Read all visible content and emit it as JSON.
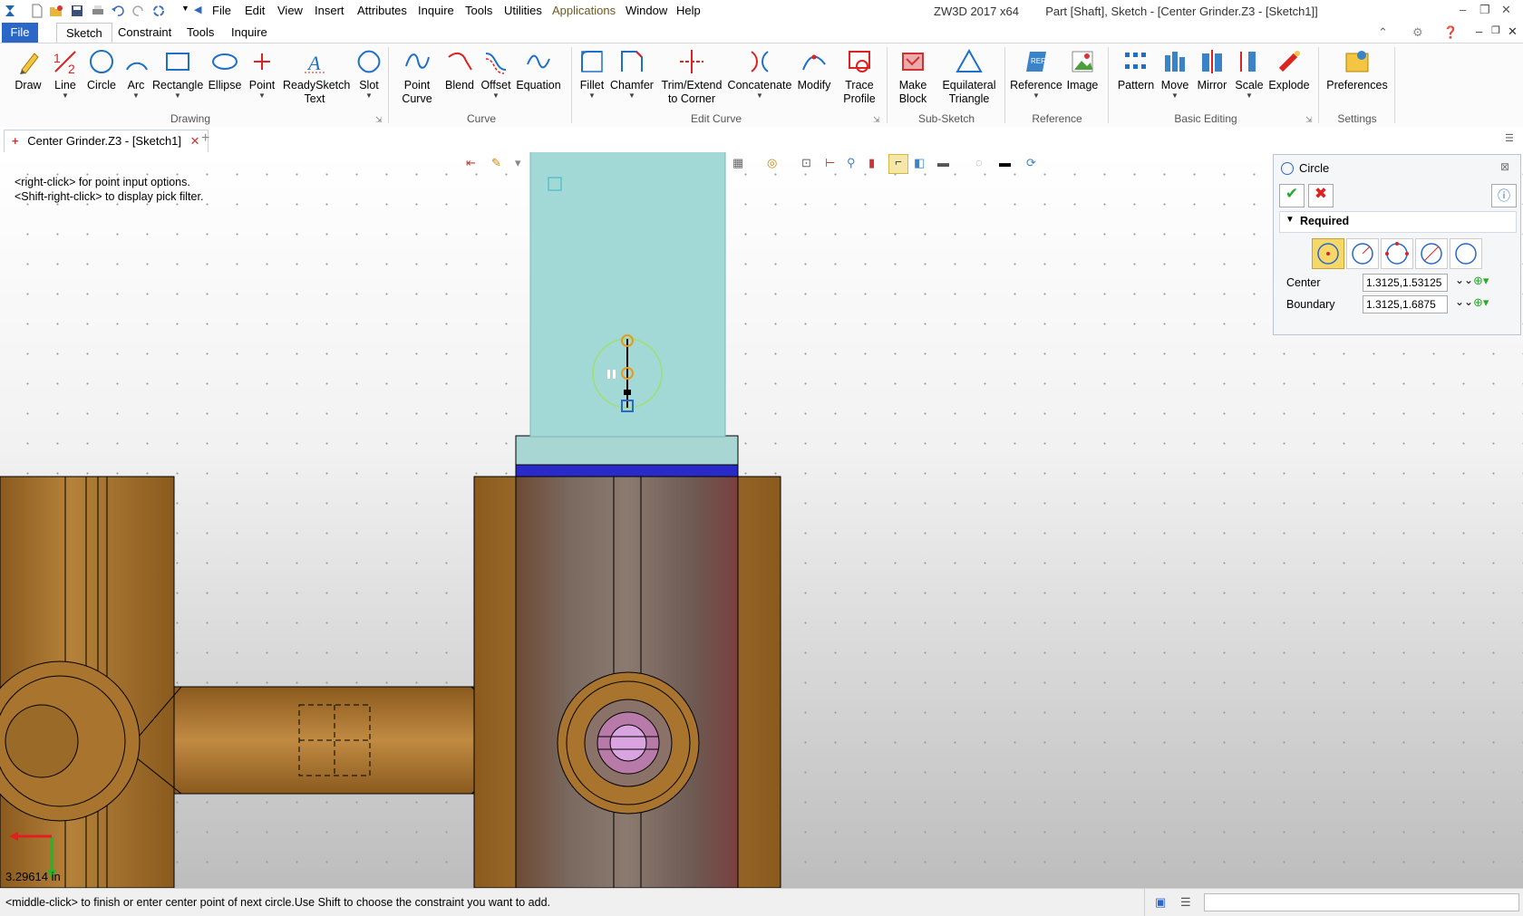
{
  "app": {
    "title": "ZW3D 2017  x64",
    "document_title": "Part [Shaft],  Sketch - [Center Grinder.Z3 - [Sketch1]]"
  },
  "menu": [
    "File",
    "Edit",
    "View",
    "Insert",
    "Attributes",
    "Inquire",
    "Tools",
    "Utilities",
    "Applications",
    "Window",
    "Help"
  ],
  "ribbon_tabs": {
    "file": "File",
    "sketch": "Sketch",
    "constraint": "Constraint",
    "tools": "Tools",
    "inquire": "Inquire"
  },
  "ribbon": {
    "drawing": {
      "label": "Drawing",
      "draw": "Draw",
      "line": "Line",
      "circle": "Circle",
      "arc": "Arc",
      "rectangle": "Rectangle",
      "ellipse": "Ellipse",
      "point": "Point",
      "readysketch_text": "ReadySketch Text",
      "slot": "Slot"
    },
    "curve": {
      "label": "Curve",
      "point_curve": "Point Curve",
      "blend": "Blend",
      "offset": "Offset",
      "equation": "Equation"
    },
    "edit_curve": {
      "label": "Edit Curve",
      "fillet": "Fillet",
      "chamfer": "Chamfer",
      "trim_extend": "Trim/Extend to Corner",
      "concatenate": "Concatenate",
      "modify": "Modify",
      "trace_profile": "Trace Profile"
    },
    "sub_sketch": {
      "label": "Sub-Sketch",
      "make_block": "Make Block",
      "equilateral_triangle": "Equilateral Triangle"
    },
    "reference": {
      "label": "Reference",
      "reference": "Reference",
      "image": "Image"
    },
    "basic_editing": {
      "label": "Basic Editing",
      "pattern": "Pattern",
      "move": "Move",
      "mirror": "Mirror",
      "scale": "Scale",
      "explode": "Explode"
    },
    "settings": {
      "label": "Settings",
      "preferences": "Preferences"
    }
  },
  "doc_tab": {
    "label": "Center Grinder.Z3 - [Sketch1]"
  },
  "viewport": {
    "hint_line1": "<right-click> for point input options.",
    "hint_line2": "<Shift-right-click> to display pick filter.",
    "scale_readout": "3.29614 in"
  },
  "circle_panel": {
    "title": "Circle",
    "section": "Required",
    "center_label": "Center",
    "center_value": "1.3125,1.53125",
    "boundary_label": "Boundary",
    "boundary_value": "1.3125,1.6875"
  },
  "status": {
    "message": "<middle-click> to finish or enter center point of next circle.Use Shift to choose the constraint you want to add."
  },
  "colors": {
    "accent": "#2a67c7",
    "part_brown": "#a8742e",
    "cylinder_teal": "#a2d8d6",
    "collar_blue": "#2a2ac8"
  }
}
